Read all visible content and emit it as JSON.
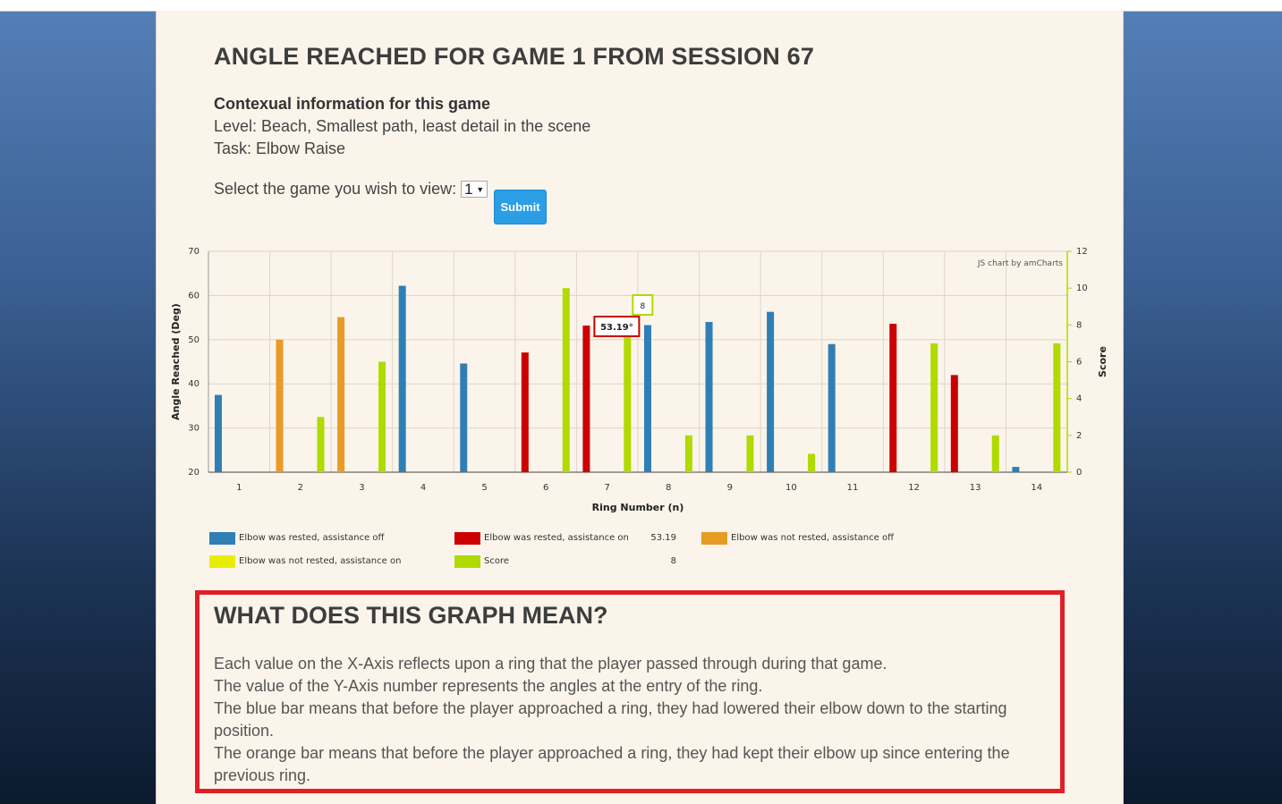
{
  "page": {
    "title": "ANGLE REACHED FOR GAME 1 FROM SESSION 67",
    "context_heading": "Contexual information for this game",
    "level": "Level: Beach, Smallest path, least detail in the scene",
    "task": "Task: Elbow Raise",
    "select_label": "Select the game you wish to view:",
    "select_value": "1",
    "submit_label": "Submit"
  },
  "chart_data": {
    "type": "bar",
    "xlabel": "Ring Number (n)",
    "ylabel": "Angle Reached (Deg)",
    "y2label": "Score",
    "ylim": [
      20,
      70
    ],
    "y2lim": [
      0,
      12
    ],
    "y_ticks": [
      20,
      30,
      40,
      50,
      60,
      70
    ],
    "y2_ticks": [
      0,
      2,
      4,
      6,
      8,
      10,
      12
    ],
    "categories": [
      "1",
      "2",
      "3",
      "4",
      "5",
      "6",
      "7",
      "8",
      "9",
      "10",
      "11",
      "12",
      "13",
      "14"
    ],
    "credit": "JS chart by amCharts",
    "grid": true,
    "series": [
      {
        "name": "Elbow was rested, assistance off",
        "axis": "left",
        "color": "#2f7fb6",
        "slot": 0,
        "values": [
          37.5,
          null,
          null,
          62.2,
          44.6,
          null,
          null,
          53.3,
          54,
          56.3,
          49,
          null,
          null,
          21.2
        ]
      },
      {
        "name": "Elbow was rested, assistance on",
        "axis": "left",
        "color": "#cc0000",
        "slot": 0,
        "values": [
          null,
          null,
          null,
          null,
          null,
          47.1,
          53.19,
          null,
          null,
          null,
          null,
          53.6,
          42,
          null
        ]
      },
      {
        "name": "Elbow was not rested, assistance off",
        "axis": "left",
        "color": "#e89b25",
        "slot": 0,
        "values": [
          null,
          50,
          55.1,
          null,
          null,
          null,
          null,
          null,
          null,
          null,
          null,
          null,
          null,
          null
        ]
      },
      {
        "name": "Elbow was not rested, assistance on",
        "axis": "left",
        "color": "#e8ee00",
        "slot": 1,
        "values": [
          null,
          null,
          null,
          null,
          null,
          null,
          null,
          null,
          null,
          null,
          null,
          null,
          null,
          null
        ]
      },
      {
        "name": "Score",
        "axis": "right",
        "color": "#b0da00",
        "slot": 1,
        "values": [
          null,
          3,
          6,
          null,
          null,
          10,
          7.6,
          2,
          2,
          1,
          null,
          7,
          2,
          7
        ]
      }
    ],
    "hover": {
      "category": "7",
      "angle_label": "53.19°",
      "score_label": "8"
    },
    "legend": [
      {
        "label": "Elbow was rested, assistance off",
        "color": "#2f7fb6",
        "value": ""
      },
      {
        "label": "Elbow was rested, assistance on",
        "color": "#cc0000",
        "value": "53.19"
      },
      {
        "label": "Elbow was not rested, assistance off",
        "color": "#e89b25",
        "value": ""
      },
      {
        "label": "Elbow was not rested, assistance on",
        "color": "#e8ee00",
        "value": ""
      },
      {
        "label": "Score",
        "color": "#b0da00",
        "value": "8"
      }
    ]
  },
  "explanation": {
    "heading": "WHAT DOES THIS GRAPH MEAN?",
    "lines": [
      "Each value on the X-Axis reflects upon a ring that the player passed through during that game.",
      "The value of the Y-Axis number represents the angles at the entry of the ring.",
      "The blue bar means that before the player approached a ring, they had lowered their elbow down to the starting position.",
      "The orange bar means that before the player approached a ring, they had kept their elbow up since entering the previous ring."
    ]
  }
}
